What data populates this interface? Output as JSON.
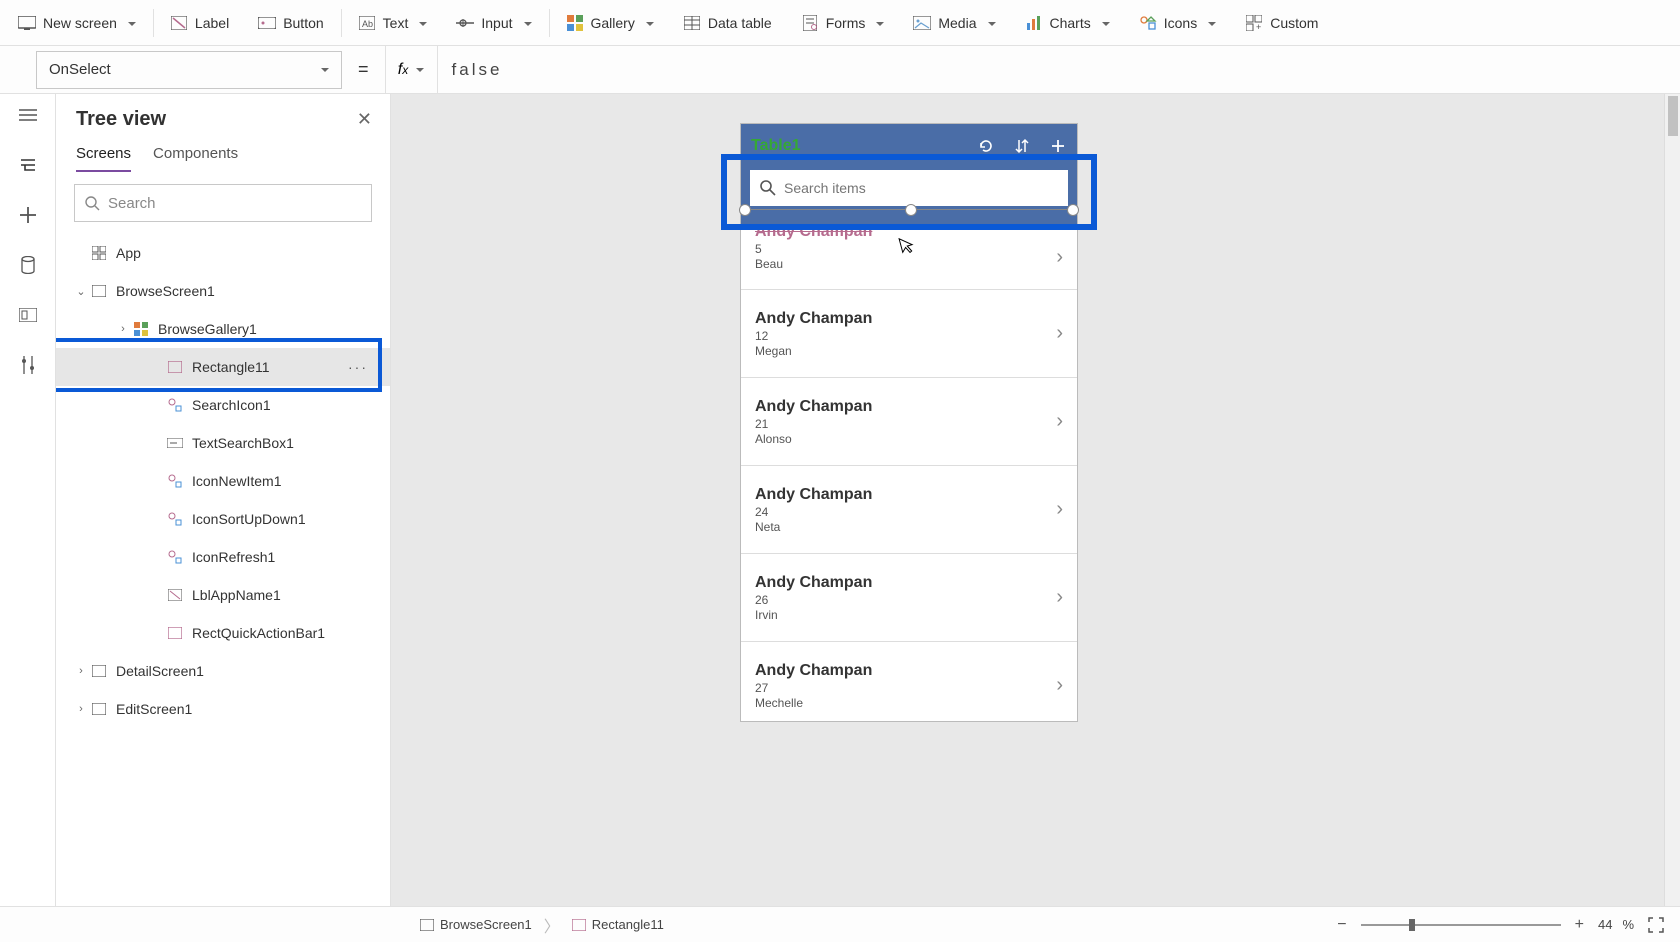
{
  "ribbon": {
    "new_screen": "New screen",
    "label": "Label",
    "button": "Button",
    "text": "Text",
    "input": "Input",
    "gallery": "Gallery",
    "data_table": "Data table",
    "forms": "Forms",
    "media": "Media",
    "charts": "Charts",
    "icons": "Icons",
    "custom": "Custom"
  },
  "formula": {
    "property": "OnSelect",
    "value": "false"
  },
  "tree": {
    "title": "Tree view",
    "tabs": {
      "screens": "Screens",
      "components": "Components"
    },
    "search_placeholder": "Search",
    "items": {
      "app": "App",
      "browse_screen": "BrowseScreen1",
      "browse_gallery": "BrowseGallery1",
      "rectangle11": "Rectangle11",
      "search_icon": "SearchIcon1",
      "text_search_box": "TextSearchBox1",
      "icon_new_item": "IconNewItem1",
      "icon_sort": "IconSortUpDown1",
      "icon_refresh": "IconRefresh1",
      "lbl_app_name": "LblAppName1",
      "rect_quick_action": "RectQuickActionBar1",
      "detail_screen": "DetailScreen1",
      "edit_screen": "EditScreen1"
    }
  },
  "preview": {
    "app_title": "Table1",
    "search_placeholder": "Search items",
    "gallery": [
      {
        "title": "Andy Champan",
        "sub1": "5",
        "sub2": "Beau"
      },
      {
        "title": "Andy Champan",
        "sub1": "12",
        "sub2": "Megan"
      },
      {
        "title": "Andy Champan",
        "sub1": "21",
        "sub2": "Alonso"
      },
      {
        "title": "Andy Champan",
        "sub1": "24",
        "sub2": "Neta"
      },
      {
        "title": "Andy Champan",
        "sub1": "26",
        "sub2": "Irvin"
      },
      {
        "title": "Andy Champan",
        "sub1": "27",
        "sub2": "Mechelle"
      }
    ]
  },
  "breadcrumb": {
    "screen": "BrowseScreen1",
    "control": "Rectangle11"
  },
  "zoom": {
    "value": "44",
    "unit": "%"
  }
}
